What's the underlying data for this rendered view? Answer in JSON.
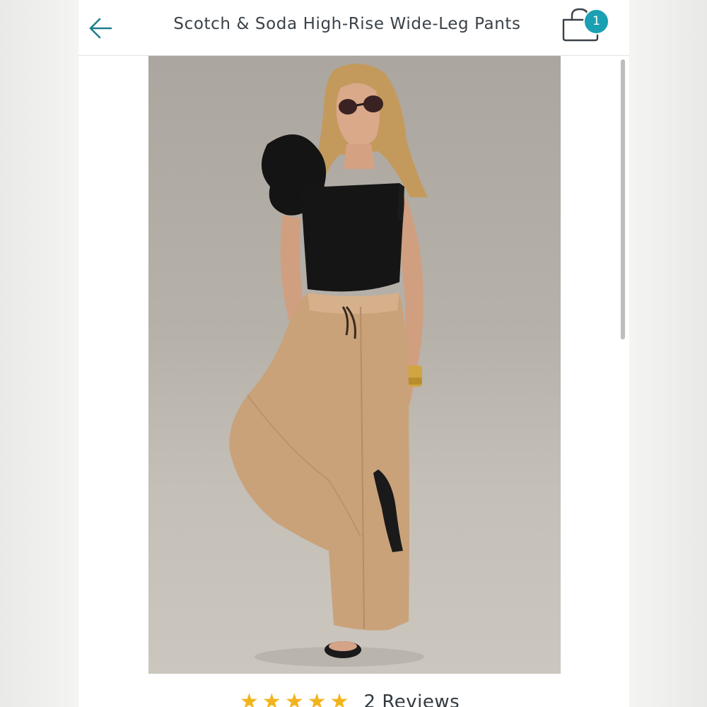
{
  "header": {
    "title": "Scotch & Soda High-Rise Wide-Leg Pants",
    "back_icon": "arrow-left-icon",
    "cart_icon": "shopping-bag-icon",
    "cart_count": "1"
  },
  "product": {
    "image_subject": "model wearing tan wide-leg pants and black one-shoulder ruffle top"
  },
  "rating": {
    "stars": 5,
    "reviews_label": "2 Reviews"
  },
  "colors": {
    "accent": "#1aa0b2",
    "star": "#f2b41d",
    "title_text": "#3a4148"
  }
}
